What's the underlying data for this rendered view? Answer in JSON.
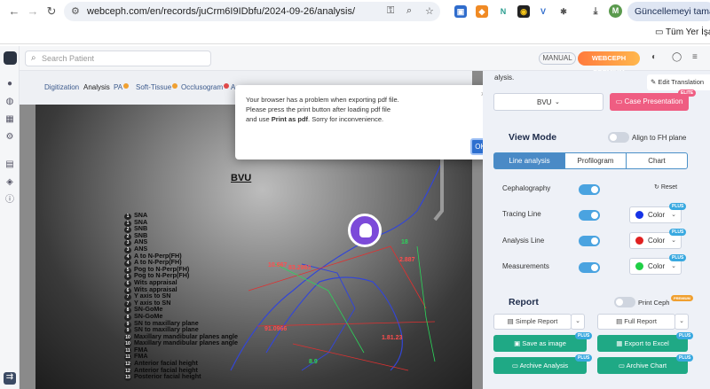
{
  "browser": {
    "url": "webceph.com/en/records/juCrm6I9IDbfu/2024-09-26/analysis/",
    "update_button": "Güncellemeyi tamamla",
    "bookmark_folder": "Tüm Yer İşaretleri",
    "profile_initial": "M"
  },
  "header": {
    "search_placeholder": "Search Patient",
    "manual_label": "MANUAL",
    "premium_label": "WEBCEPH PREMIUM"
  },
  "tabs": [
    {
      "label": "Digitization"
    },
    {
      "label": "Analysis"
    },
    {
      "label": "PA"
    },
    {
      "label": "Soft-Tissue"
    },
    {
      "label": "Occlusogram"
    },
    {
      "label": "A"
    }
  ],
  "xray": {
    "title": "BVU",
    "legend": [
      "SNA",
      "SNA",
      "SNB",
      "SNB",
      "ANS",
      "ANS",
      "A to N-Perp(FH)",
      "A to N-Perp(FH)",
      "Pog to N-Perp(FH)",
      "Pog to N-Perp(FH)",
      "Wits appraisal",
      "Wits appraisal",
      "Y axis to SN",
      "Y axis to SN",
      "SN-GoMe",
      "SN-GoMe",
      "SN to maxillary plane",
      "SN to maxillary plane",
      "Maxillary mandibular planes angle",
      "Maxillary mandibular planes angle",
      "FMA",
      "FMA",
      "Anterior facial height",
      "Anterior facial height",
      "Posterior facial height"
    ],
    "labels": [
      {
        "text": "10.667",
        "color": "red"
      },
      {
        "text": "91.0966",
        "color": "red"
      },
      {
        "text": "83.2983",
        "color": "red"
      },
      {
        "text": "1.81.23",
        "color": "red"
      },
      {
        "text": "2.887",
        "color": "red"
      },
      {
        "text": "8.9",
        "color": "green"
      },
      {
        "text": "18",
        "color": "green"
      }
    ]
  },
  "modal": {
    "message_line1": "Your browser has a problem when exporting pdf file.",
    "message_line2": "Please press the print button after loading pdf file",
    "message_line3_pre": "and use ",
    "message_line3_bold": "Print as pdf",
    "message_line3_post": ". Sorry for inconvenience.",
    "ok_label": "OK",
    "close": "×"
  },
  "panel": {
    "analysis_text": "alysis.",
    "edit_translation": "Edit Translation",
    "analysis_select": "BVU",
    "case_presentation": "Case Presentation",
    "elite_badge": "ELITE",
    "view_mode_title": "View Mode",
    "align_fh": "Align to FH plane",
    "segments": [
      "Line analysis",
      "Profilogram",
      "Chart"
    ],
    "cephalography": "Cephalography",
    "reset": "Reset",
    "tracing_line": "Tracing Line",
    "analysis_line": "Analysis Line",
    "measurements": "Measurements",
    "color_label": "Color",
    "plus_badge": "PLUS",
    "colors": {
      "tracing": "#1633e6",
      "analysis": "#e02020",
      "measurements": "#1fcf45"
    },
    "report_title": "Report",
    "print_ceph": "Print Ceph",
    "premium_badge": "PREMIUM",
    "simple_report": "Simple Report",
    "full_report": "Full Report",
    "save_image": "Save as image",
    "export_excel": "Export to Excel",
    "archive_analysis": "Archive Analysis",
    "archive_chart": "Archive Chart"
  }
}
